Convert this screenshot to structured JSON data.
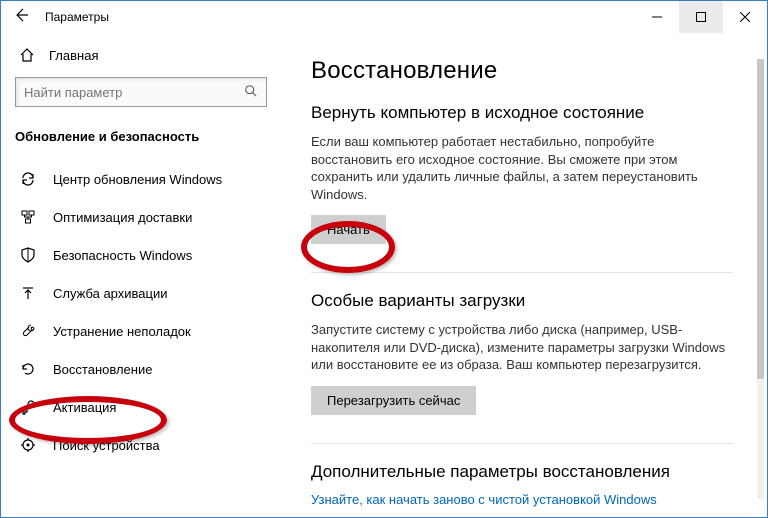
{
  "titlebar": {
    "title": "Параметры"
  },
  "sidebar": {
    "home_label": "Главная",
    "search_placeholder": "Найти параметр",
    "group_title": "Обновление и безопасность",
    "items": [
      {
        "label": "Центр обновления Windows"
      },
      {
        "label": "Оптимизация доставки"
      },
      {
        "label": "Безопасность Windows"
      },
      {
        "label": "Служба архивации"
      },
      {
        "label": "Устранение неполадок"
      },
      {
        "label": "Восстановление"
      },
      {
        "label": "Активация"
      },
      {
        "label": "Поиск устройства"
      }
    ]
  },
  "main": {
    "heading": "Восстановление",
    "section1": {
      "title": "Вернуть компьютер в исходное состояние",
      "desc": "Если ваш компьютер работает нестабильно, попробуйте восстановить его исходное состояние. Вы сможете при этом сохранить или удалить личные файлы, а затем переустановить Windows.",
      "button": "Начать"
    },
    "section2": {
      "title": "Особые варианты загрузки",
      "desc": "Запустите систему с устройства либо диска (например, USB-накопителя или DVD-диска), измените параметры загрузки Windows или восстановите ее из образа. Ваш компьютер перезагрузится.",
      "button": "Перезагрузить сейчас"
    },
    "section3": {
      "title": "Дополнительные параметры восстановления",
      "link": "Узнайте, как начать заново с чистой установкой Windows"
    }
  }
}
